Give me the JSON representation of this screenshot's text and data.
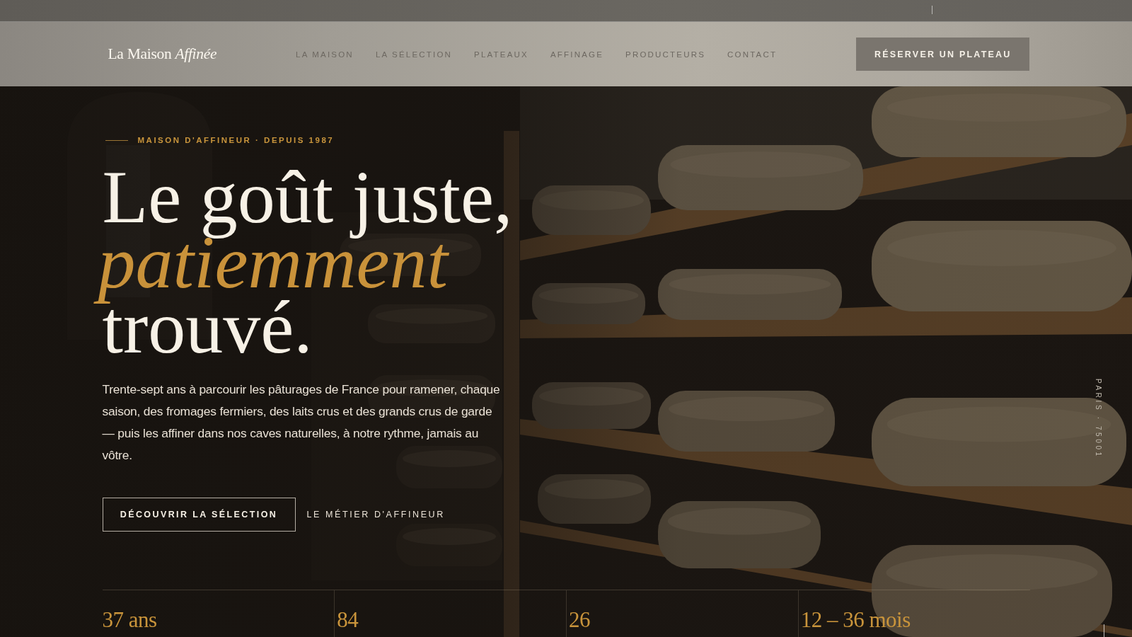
{
  "nav": {
    "logo": "La Maison *Affinée*",
    "links": [
      {
        "label": "LA MAISON"
      },
      {
        "label": "LA SÉLECTION"
      },
      {
        "label": "PLATEAUX"
      },
      {
        "label": "AFFINAGE"
      },
      {
        "label": "PRODUCTEURS"
      },
      {
        "label": "CONTACT"
      }
    ],
    "cta": "RÉSERVER UN PLATEAU"
  },
  "hero": {
    "eyebrow": "MAISON D'AFFINEUR · DEPUIS 1987",
    "headline": [
      {
        "text": "Le goût juste,",
        "kind": "plain"
      },
      {
        "text": "patiemment",
        "kind": "accent"
      },
      {
        "text": "trouvé.",
        "kind": "plain"
      }
    ],
    "intro": "Trente-sept ans à parcourir les pâturages de France pour ramener, chaque saison, des fromages fermiers, des laits crus et des grands crus de garde — puis les affiner dans nos caves naturelles, à notre rythme, jamais au vôtre.",
    "primary_button": "DÉCOUVRIR LA SÉLECTION",
    "secondary_link": "LE MÉTIER D'AFFINEUR",
    "side_label": "PARIS · 75001"
  },
  "stats": [
    {
      "value": "37 ans"
    },
    {
      "value": "84"
    },
    {
      "value": "26"
    },
    {
      "value": "12 – 36 mois"
    }
  ]
}
